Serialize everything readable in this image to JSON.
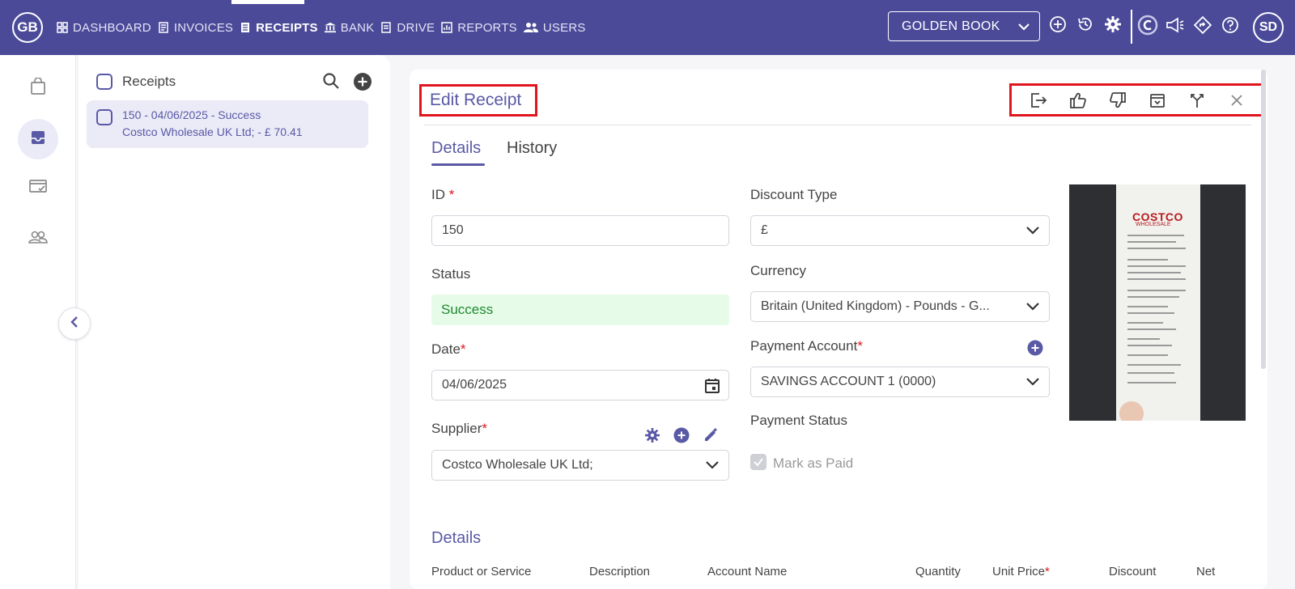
{
  "header": {
    "logo": "GB",
    "nav": [
      {
        "label": "DASHBOARD",
        "icon": "grid-icon"
      },
      {
        "label": "INVOICES",
        "icon": "invoice-icon"
      },
      {
        "label": "RECEIPTS",
        "icon": "receipt-icon",
        "active": true
      },
      {
        "label": "BANK",
        "icon": "bank-icon"
      },
      {
        "label": "DRIVE",
        "icon": "drive-icon"
      },
      {
        "label": "REPORTS",
        "icon": "reports-icon"
      },
      {
        "label": "USERS",
        "icon": "users-icon"
      }
    ],
    "book_selector": "GOLDEN BOOK",
    "user_initials": "SD"
  },
  "list": {
    "title": "Receipts",
    "items": [
      {
        "line1": "150 - 04/06/2025 - Success",
        "line2": "Costco Wholesale UK Ltd; - £ 70.41"
      }
    ]
  },
  "editor": {
    "title": "Edit Receipt",
    "tabs": [
      "Details",
      "History"
    ],
    "id_label": "ID",
    "id_value": "150",
    "status_label": "Status",
    "status_value": "Success",
    "date_label": "Date",
    "date_value": "04/06/2025",
    "supplier_label": "Supplier",
    "supplier_value": "Costco Wholesale UK Ltd;",
    "discount_type_label": "Discount Type",
    "discount_type_value": "£",
    "currency_label": "Currency",
    "currency_value": "Britain (United Kingdom) - Pounds - G...",
    "payment_account_label": "Payment Account",
    "payment_account_value": "SAVINGS ACCOUNT 1 (0000)",
    "payment_status_label": "Payment Status",
    "mark_as_paid_label": "Mark as Paid",
    "details_section_title": "Details",
    "columns": [
      "Product or Service",
      "Description",
      "Account Name",
      "Quantity",
      "Unit Price",
      "Discount",
      "Net"
    ],
    "receipt_brand": "COSTCO",
    "receipt_brand_sub": "WHOLESALE"
  },
  "colors": {
    "header_bg": "#4b4a99",
    "accent": "#5a59a6",
    "success_bg": "#e7fbe9",
    "success_text": "#1d8a2e",
    "highlight_border": "#e0151d"
  }
}
